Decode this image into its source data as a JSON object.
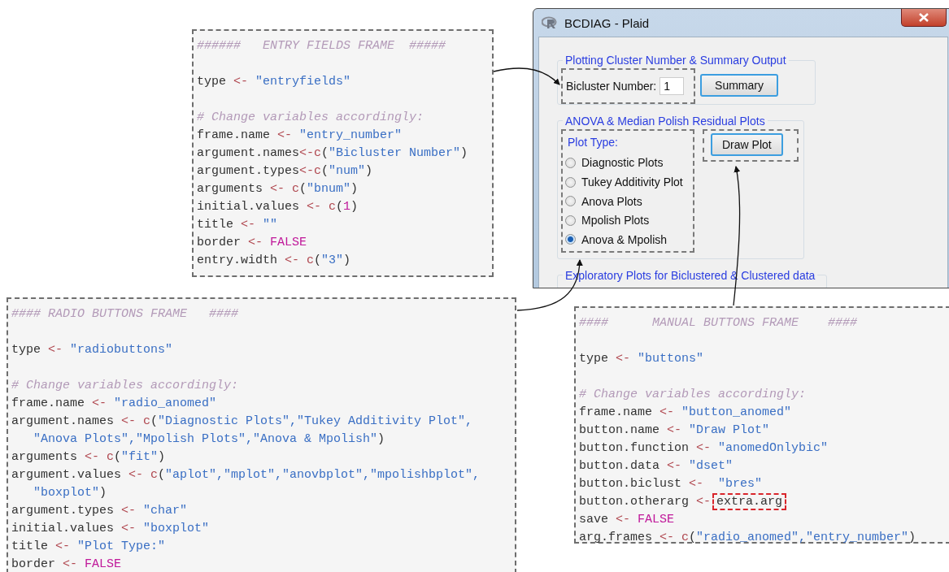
{
  "entry_frame_code": {
    "sections": [
      {
        "lines": [
          [
            {
              "kind": "comment",
              "text": "######   ENTRY FIELDS FRAME  #####"
            }
          ]
        ]
      },
      {
        "lines": [
          [
            {
              "kind": "plain",
              "text": "type "
            },
            {
              "kind": "op",
              "text": "<- "
            },
            {
              "kind": "string",
              "text": "\"entryfields\""
            }
          ]
        ]
      },
      {
        "lines": [
          [
            {
              "kind": "comment",
              "text": "# Change variables accordingly:"
            }
          ],
          [
            {
              "kind": "plain",
              "text": "frame.name "
            },
            {
              "kind": "op",
              "text": "<- "
            },
            {
              "kind": "string",
              "text": "\"entry_number\""
            }
          ],
          [
            {
              "kind": "plain",
              "text": "argument.names"
            },
            {
              "kind": "op",
              "text": "<-c"
            },
            {
              "kind": "plain",
              "text": "("
            },
            {
              "kind": "string",
              "text": "\"Bicluster Number\""
            },
            {
              "kind": "plain",
              "text": ")"
            }
          ],
          [
            {
              "kind": "plain",
              "text": "argument.types"
            },
            {
              "kind": "op",
              "text": "<-c"
            },
            {
              "kind": "plain",
              "text": "("
            },
            {
              "kind": "string",
              "text": "\"num\""
            },
            {
              "kind": "plain",
              "text": ")"
            }
          ],
          [
            {
              "kind": "plain",
              "text": "arguments "
            },
            {
              "kind": "op",
              "text": "<- c"
            },
            {
              "kind": "plain",
              "text": "("
            },
            {
              "kind": "string",
              "text": "\"bnum\""
            },
            {
              "kind": "plain",
              "text": ")"
            }
          ],
          [
            {
              "kind": "plain",
              "text": "initial.values "
            },
            {
              "kind": "op",
              "text": "<- c"
            },
            {
              "kind": "plain",
              "text": "("
            },
            {
              "kind": "number",
              "text": "1"
            },
            {
              "kind": "plain",
              "text": ")"
            }
          ],
          [
            {
              "kind": "plain",
              "text": "title "
            },
            {
              "kind": "op",
              "text": "<- "
            },
            {
              "kind": "string",
              "text": "\"\""
            }
          ],
          [
            {
              "kind": "plain",
              "text": "border "
            },
            {
              "kind": "op",
              "text": "<- "
            },
            {
              "kind": "keyword",
              "text": "FALSE"
            }
          ],
          [
            {
              "kind": "plain",
              "text": "entry.width "
            },
            {
              "kind": "op",
              "text": "<- c"
            },
            {
              "kind": "plain",
              "text": "("
            },
            {
              "kind": "string",
              "text": "\"3\""
            },
            {
              "kind": "plain",
              "text": ")"
            }
          ]
        ]
      }
    ]
  },
  "dialog": {
    "title": "BCDIAG - Plaid",
    "groups": [
      {
        "kind": "entry",
        "title": "Plotting Cluster Number & Summary Output",
        "field_label": "Bicluster Number:",
        "field_value": "1",
        "button": "Summary"
      },
      {
        "kind": "radio",
        "title": "ANOVA & Median Polish Residual Plots",
        "radio_title": "Plot Type:",
        "options": [
          {
            "label": "Diagnostic Plots",
            "selected": false
          },
          {
            "label": "Tukey Additivity Plot",
            "selected": false
          },
          {
            "label": "Anova Plots",
            "selected": false
          },
          {
            "label": "Mpolish Plots",
            "selected": false
          },
          {
            "label": "Anova & Mpolish",
            "selected": true
          }
        ],
        "button": "Draw Plot"
      },
      {
        "kind": "cut",
        "title": "Exploratory Plots for Biclustered & Clustered data"
      }
    ]
  },
  "radio_frame_code": {
    "sections": [
      {
        "lines": [
          [
            {
              "kind": "comment",
              "text": "#### RADIO BUTTONS FRAME   ####"
            }
          ]
        ]
      },
      {
        "lines": [
          [
            {
              "kind": "plain",
              "text": "type "
            },
            {
              "kind": "op",
              "text": "<- "
            },
            {
              "kind": "string",
              "text": "\"radiobuttons\""
            }
          ]
        ]
      },
      {
        "lines": [
          [
            {
              "kind": "comment",
              "text": "# Change variables accordingly:"
            }
          ],
          [
            {
              "kind": "plain",
              "text": "frame.name "
            },
            {
              "kind": "op",
              "text": "<- "
            },
            {
              "kind": "string",
              "text": "\"radio_anomed\""
            }
          ],
          [
            {
              "kind": "plain",
              "text": "argument.names "
            },
            {
              "kind": "op",
              "text": "<- c"
            },
            {
              "kind": "plain",
              "text": "("
            },
            {
              "kind": "string",
              "text": "\"Diagnostic Plots\",\"Tukey Additivity Plot\","
            }
          ],
          [
            {
              "kind": "string",
              "text": "   \"Anova Plots\",\"Mpolish Plots\",\"Anova & Mpolish\""
            },
            {
              "kind": "plain",
              "text": ")"
            }
          ],
          [
            {
              "kind": "plain",
              "text": "arguments "
            },
            {
              "kind": "op",
              "text": "<- c"
            },
            {
              "kind": "plain",
              "text": "("
            },
            {
              "kind": "string",
              "text": "\"fit\""
            },
            {
              "kind": "plain",
              "text": ")"
            }
          ],
          [
            {
              "kind": "plain",
              "text": "argument.values "
            },
            {
              "kind": "op",
              "text": "<- c"
            },
            {
              "kind": "plain",
              "text": "("
            },
            {
              "kind": "string",
              "text": "\"aplot\",\"mplot\",\"anovbplot\",\"mpolishbplot\","
            }
          ],
          [
            {
              "kind": "string",
              "text": "   \"boxplot\""
            },
            {
              "kind": "plain",
              "text": ")"
            }
          ],
          [
            {
              "kind": "plain",
              "text": "argument.types "
            },
            {
              "kind": "op",
              "text": "<- "
            },
            {
              "kind": "string",
              "text": "\"char\""
            }
          ],
          [
            {
              "kind": "plain",
              "text": "initial.values "
            },
            {
              "kind": "op",
              "text": "<- "
            },
            {
              "kind": "string",
              "text": "\"boxplot\""
            }
          ],
          [
            {
              "kind": "plain",
              "text": "title "
            },
            {
              "kind": "op",
              "text": "<- "
            },
            {
              "kind": "string",
              "text": "\"Plot Type:\""
            }
          ],
          [
            {
              "kind": "plain",
              "text": "border "
            },
            {
              "kind": "op",
              "text": "<- "
            },
            {
              "kind": "keyword",
              "text": "FALSE"
            }
          ]
        ]
      }
    ]
  },
  "buttons_frame_code": {
    "sections": [
      {
        "lines": [
          [
            {
              "kind": "comment",
              "text": "####      MANUAL BUTTONS FRAME    ####"
            }
          ]
        ]
      },
      {
        "lines": [
          [
            {
              "kind": "plain",
              "text": "type "
            },
            {
              "kind": "op",
              "text": "<- "
            },
            {
              "kind": "string",
              "text": "\"buttons\""
            }
          ]
        ]
      },
      {
        "lines": [
          [
            {
              "kind": "comment",
              "text": "# Change variables accordingly:"
            }
          ],
          [
            {
              "kind": "plain",
              "text": "frame.name "
            },
            {
              "kind": "op",
              "text": "<- "
            },
            {
              "kind": "string",
              "text": "\"button_anomed\""
            }
          ],
          [
            {
              "kind": "plain",
              "text": "button.name "
            },
            {
              "kind": "op",
              "text": "<- "
            },
            {
              "kind": "string",
              "text": "\"Draw Plot\""
            }
          ],
          [
            {
              "kind": "plain",
              "text": "button.function "
            },
            {
              "kind": "op",
              "text": "<- "
            },
            {
              "kind": "string",
              "text": "\"anomedOnlybic\""
            }
          ],
          [
            {
              "kind": "plain",
              "text": "button.data "
            },
            {
              "kind": "op",
              "text": "<- "
            },
            {
              "kind": "string",
              "text": "\"dset\""
            }
          ],
          [
            {
              "kind": "plain",
              "text": "button.biclust "
            },
            {
              "kind": "op",
              "text": "<-  "
            },
            {
              "kind": "string",
              "text": "\"bres\""
            }
          ],
          [
            {
              "kind": "plain",
              "text": "button.otherarg "
            },
            {
              "kind": "op",
              "text": "<-"
            },
            {
              "kind": "highlight",
              "text": "extra.arg"
            }
          ],
          [
            {
              "kind": "plain",
              "text": "save "
            },
            {
              "kind": "op",
              "text": "<- "
            },
            {
              "kind": "keyword",
              "text": "FALSE"
            }
          ],
          [
            {
              "kind": "plain",
              "text": "arg.frames "
            },
            {
              "kind": "op",
              "text": "<- c"
            },
            {
              "kind": "plain",
              "text": "("
            },
            {
              "kind": "string",
              "text": "\"radio_anomed\",\"entry_number\""
            },
            {
              "kind": "plain",
              "text": ")"
            }
          ]
        ]
      }
    ]
  }
}
